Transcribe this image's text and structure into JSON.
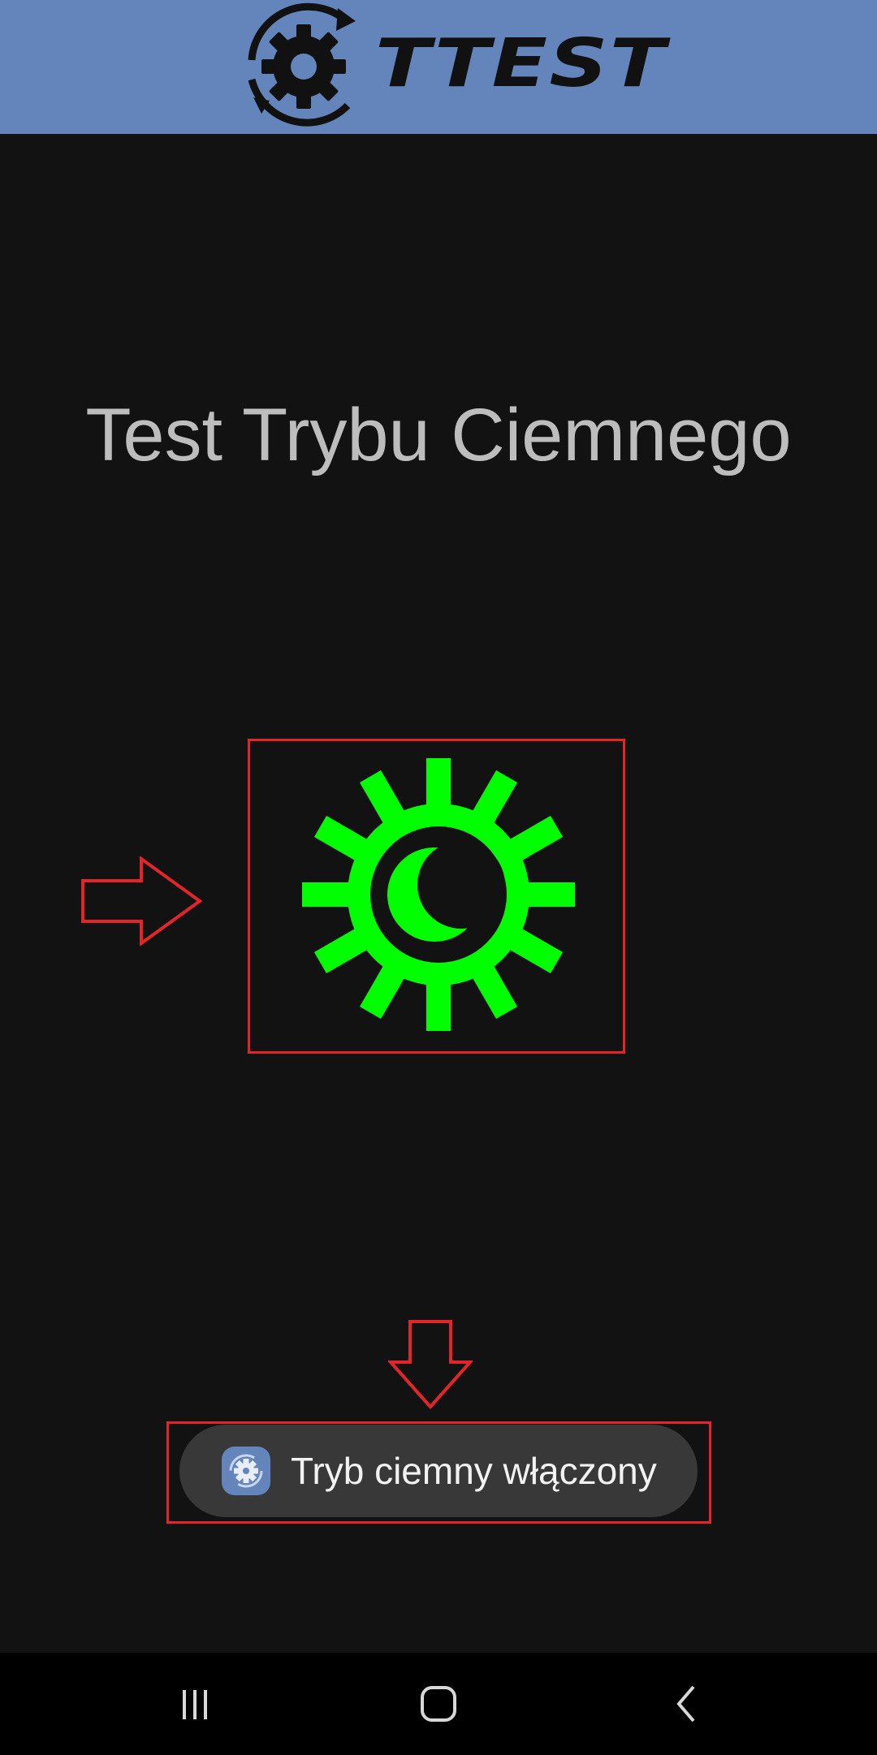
{
  "header": {
    "logo_text": "TTEST",
    "background_color": "#6485bb"
  },
  "main": {
    "title": "Test Trybu Ciemnego",
    "toggle_icon": "sun-moon-icon",
    "icon_color": "#00ff00"
  },
  "annotations": {
    "highlight_color": "#e32428",
    "arrows": [
      "arrow-right-icon",
      "arrow-down-icon"
    ]
  },
  "toast": {
    "app_icon": "gear-icon",
    "message": "Tryb ciemny włączony"
  },
  "navbar": {
    "buttons": [
      "recent-apps-icon",
      "home-icon",
      "back-icon"
    ]
  }
}
